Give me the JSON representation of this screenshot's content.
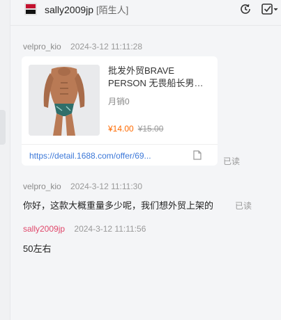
{
  "header": {
    "name": "sally2009jp",
    "relation_tag": "[陌生人]",
    "icons": [
      "history-icon",
      "checklist-dropdown-icon"
    ]
  },
  "messages": [
    {
      "sender": "velpro_kio",
      "time": "2024-3-12 11:11:28",
      "card": {
        "title": "批发外贸BRAVE PERSON 无畏船长男…",
        "sales": "月销0",
        "price": "¥14.00",
        "old_price": "¥15.00",
        "link": "https://detail.1688.com/offer/69..."
      },
      "status": "已读"
    },
    {
      "sender": "velpro_kio",
      "time": "2024-3-12 11:11:30",
      "text": "你好，这款大概重量多少呢，我们想外贸上架的",
      "status": "已读"
    },
    {
      "sender": "sally2009jp",
      "time": "2024-3-12 11:11:56",
      "text": "50左右"
    }
  ],
  "colors": {
    "sender_other": "#8a8a8a",
    "sender_me": "#e0486b",
    "price": "#ff6a00",
    "link": "#3c78d8"
  }
}
